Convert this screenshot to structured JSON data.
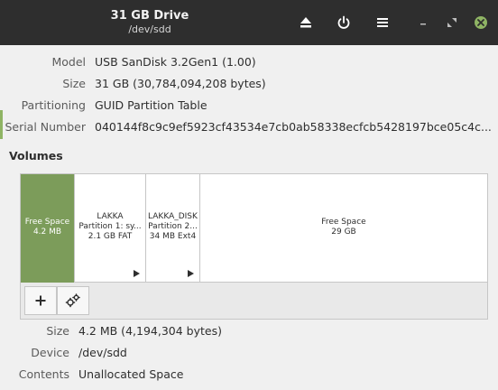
{
  "header": {
    "title": "31 GB Drive",
    "subtitle": "/dev/sdd"
  },
  "drive": {
    "model_label": "Model",
    "model_value": "USB SanDisk 3.2Gen1 (1.00)",
    "size_label": "Size",
    "size_value": "31 GB (30,784,094,208 bytes)",
    "partitioning_label": "Partitioning",
    "partitioning_value": "GUID Partition Table",
    "serial_label": "Serial Number",
    "serial_value": "040144f8c9c9ef5923cf43534e7cb0ab58338ecfcb5428197bce05c4c..."
  },
  "volumes": {
    "title": "Volumes",
    "items": [
      {
        "line1": "Free Space",
        "line2": "4.2 MB",
        "line3": ""
      },
      {
        "line1": "LAKKA",
        "line2": "Partition 1: sy...",
        "line3": "2.1 GB FAT"
      },
      {
        "line1": "LAKKA_DISK",
        "line2": "Partition 2...",
        "line3": "34 MB Ext4"
      },
      {
        "line1": "Free Space",
        "line2": "29 GB",
        "line3": ""
      }
    ]
  },
  "selected": {
    "size_label": "Size",
    "size_value": "4.2 MB (4,194,304 bytes)",
    "device_label": "Device",
    "device_value": "/dev/sdd",
    "contents_label": "Contents",
    "contents_value": "Unallocated Space"
  },
  "colors": {
    "headerbar": "#2e2e2e",
    "selected_volume": "#7c9c5a",
    "close_button": "#8fb464"
  }
}
